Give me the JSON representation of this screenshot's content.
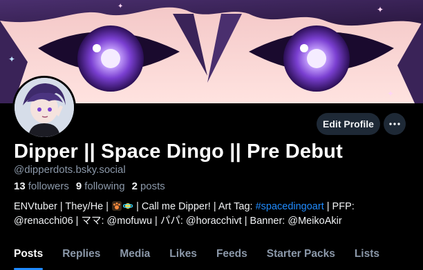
{
  "banner": {
    "description_icon": "banner-image"
  },
  "avatar": {
    "icon": "avatar-image"
  },
  "actions": {
    "edit_profile_label": "Edit Profile",
    "more_icon": "ellipsis-icon"
  },
  "profile": {
    "display_name": "Dipper || Space Dingo || Pre Debut",
    "handle": "@dipperdots.bsky.social"
  },
  "stats": {
    "followers_count": "13",
    "followers_label": "followers",
    "following_count": "9",
    "following_label": "following",
    "posts_count": "2",
    "posts_label": "posts"
  },
  "bio": {
    "part1": "ENVtuber | They/He | ",
    "part2": " | Call me Dipper! | Art Tag: ",
    "tag": "#spacedingoart",
    "part3": " | PFP:",
    "line2": "@renacchi06 | ママ: @mofuwu | パパ: @horacchivt | Banner: @MeikoAkir"
  },
  "tabs": [
    "Posts",
    "Replies",
    "Media",
    "Likes",
    "Feeds",
    "Starter Packs",
    "Lists"
  ],
  "colors": {
    "accent": "#208bfe",
    "button_bg": "#1e2936",
    "muted_text": "#8b98a9",
    "background": "#000000"
  }
}
